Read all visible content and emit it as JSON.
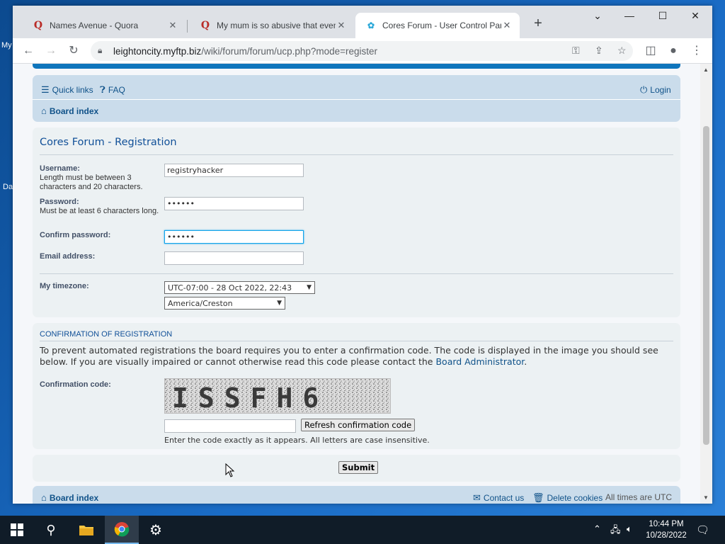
{
  "desktop": {
    "icon_labels": [
      "My",
      "Da"
    ]
  },
  "browser": {
    "tabs": [
      {
        "title": "Names Avenue - Quora",
        "icon": "quora-icon"
      },
      {
        "title": "My mum is so abusive that even",
        "icon": "quora-icon"
      },
      {
        "title": "Cores Forum - User Control Pane",
        "icon": "forum-icon"
      }
    ],
    "url_host": "leightoncity.myftp.biz",
    "url_path": "/wiki/forum/forum/ucp.php?mode=register"
  },
  "forum": {
    "nav": {
      "quick_links": "Quick links",
      "faq": "FAQ",
      "login": "Login",
      "board_index": "Board index"
    },
    "title": "Cores Forum - Registration",
    "username": {
      "label": "Username:",
      "help": "Length must be between 3 characters and 20 characters.",
      "value": "registryhacker"
    },
    "password": {
      "label": "Password:",
      "help": "Must be at least 6 characters long.",
      "value": "••••••"
    },
    "confirm_password": {
      "label": "Confirm password:",
      "value": "••••••"
    },
    "email": {
      "label": "Email address:",
      "value": ""
    },
    "timezone": {
      "label": "My timezone:",
      "offset": "UTC-07:00 - 28 Oct 2022, 22:43",
      "zone": "America/Creston"
    },
    "confirmation": {
      "heading": "Confirmation of registration",
      "text_1": "To prevent automated registrations the board requires you to enter a confirmation code. The code is displayed in the image you should see below. If you are visually impaired or cannot otherwise read this code please contact the",
      "admin_link": "Board Administrator",
      "text_2": ".",
      "code_label": "Confirmation code:",
      "captcha": "ISSFH6",
      "refresh": "Refresh confirmation code",
      "explain": "Enter the code exactly as it appears. All letters are case insensitive."
    },
    "submit": "Submit",
    "footer": {
      "board_index": "Board index",
      "contact": "Contact us",
      "delete_cookies": "Delete cookies",
      "times": "All times are UTC"
    }
  },
  "taskbar": {
    "time": "10:44 PM",
    "date": "10/28/2022"
  }
}
